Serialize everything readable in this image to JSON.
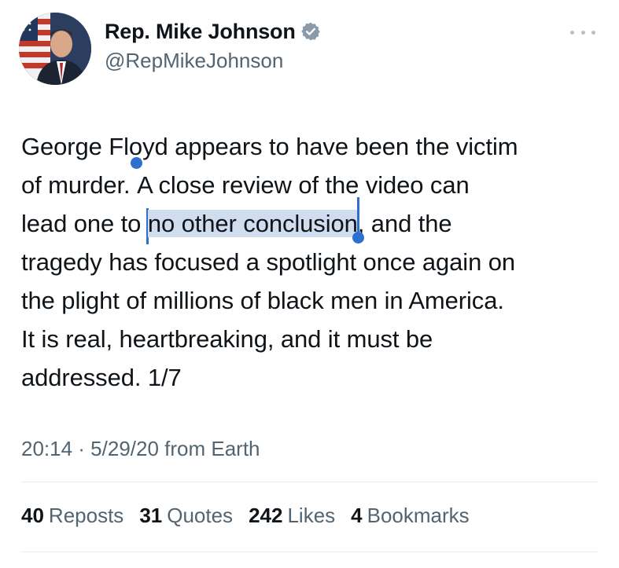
{
  "author": {
    "display_name": "Rep. Mike Johnson",
    "handle": "@RepMikeJohnson",
    "verified": true,
    "verified_color": "#8a9aa8"
  },
  "tweet": {
    "lines": [
      {
        "text": "George Floyd appears to have been the victim"
      },
      {
        "before": "of murder. ",
        "caret_char": "A",
        "after": " close review of the video can"
      },
      {
        "before": "lead one to ",
        "selected": "no other conclusion",
        "after": ", and the"
      },
      {
        "text": "tragedy has focused a spotlight once again on"
      },
      {
        "text": "the plight of millions of black men in America."
      },
      {
        "text": "It is real, heartbreaking, and it must be"
      },
      {
        "text": "addressed. 1/7"
      }
    ],
    "selection_color": "#cfddef",
    "handle_color": "#2f6fd0"
  },
  "meta": {
    "timestamp": "20:14 · 5/29/20 from Earth"
  },
  "stats": [
    {
      "count": "40",
      "label": "Reposts"
    },
    {
      "count": "31",
      "label": "Quotes"
    },
    {
      "count": "242",
      "label": "Likes"
    },
    {
      "count": "4",
      "label": "Bookmarks"
    }
  ]
}
